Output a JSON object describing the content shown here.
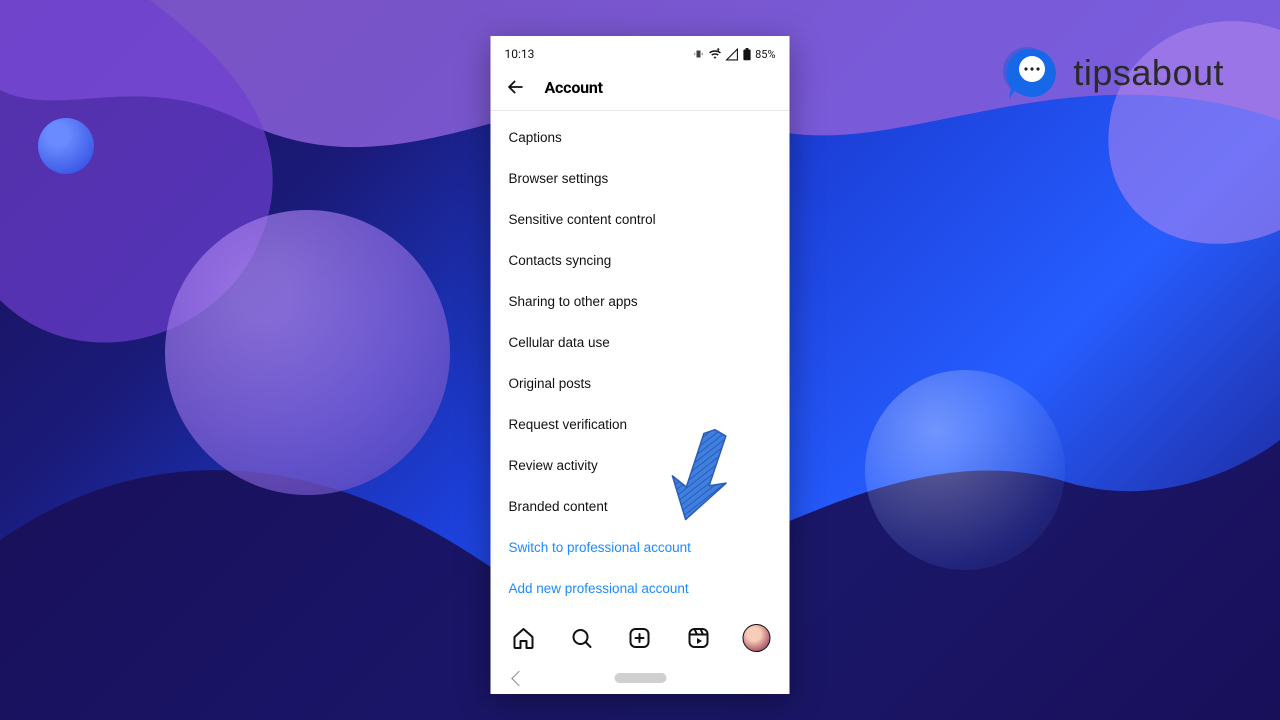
{
  "watermark": {
    "text": "tipsabout"
  },
  "status": {
    "time": "10:13",
    "battery": "85%"
  },
  "header": {
    "title": "Account"
  },
  "menu": {
    "items": [
      "Captions",
      "Browser settings",
      "Sensitive content control",
      "Contacts syncing",
      "Sharing to other apps",
      "Cellular data use",
      "Original posts",
      "Request verification",
      "Review activity",
      "Branded content"
    ],
    "links": [
      "Switch to professional account",
      "Add new professional account"
    ]
  }
}
